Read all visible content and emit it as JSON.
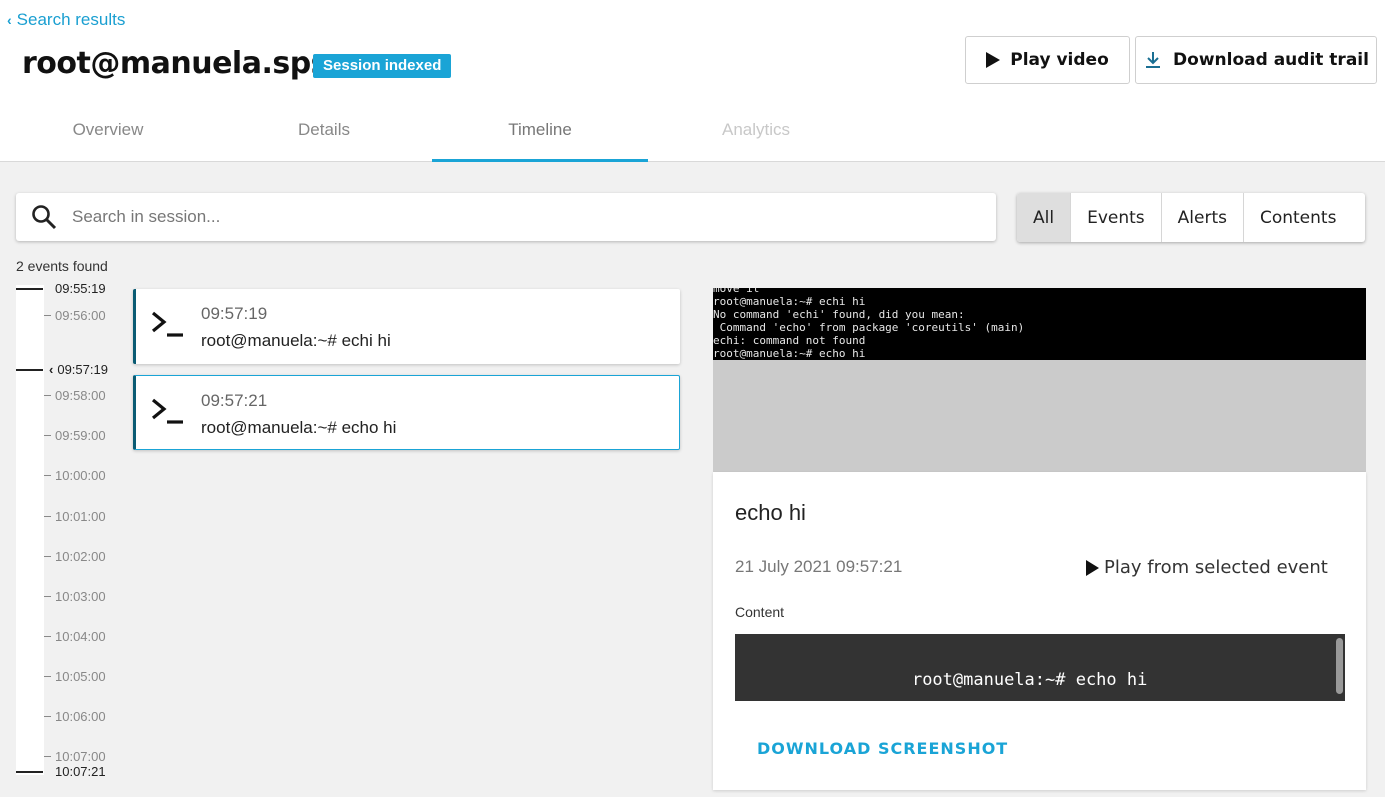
{
  "header": {
    "back_label": "Search results",
    "title": "root@manuela.sps",
    "badge": "Session indexed",
    "play_video_label": "Play video",
    "download_trail_label": "Download audit trail"
  },
  "tabs": [
    {
      "label": "Overview",
      "state": "normal"
    },
    {
      "label": "Details",
      "state": "normal"
    },
    {
      "label": "Timeline",
      "state": "active"
    },
    {
      "label": "Analytics",
      "state": "disabled"
    }
  ],
  "search": {
    "placeholder": "Search in session...",
    "value": ""
  },
  "filters": [
    "All",
    "Events",
    "Alerts",
    "Contents"
  ],
  "active_filter": "All",
  "events_count": "2 events found",
  "timeline": {
    "ticks": [
      "09:55:19",
      "09:56:00",
      "09:57:19",
      "09:58:00",
      "09:59:00",
      "10:00:00",
      "10:01:00",
      "10:02:00",
      "10:03:00",
      "10:04:00",
      "10:05:00",
      "10:06:00",
      "10:07:00",
      "10:07:21"
    ]
  },
  "events": [
    {
      "time": "09:57:19",
      "command": "root@manuela:~# echi hi"
    },
    {
      "time": "09:57:21",
      "command": "root@manuela:~# echo hi"
    }
  ],
  "screen_text": "move it\nroot@manuela:~# echi hi\nNo command 'echi' found, did you mean:\n Command 'echo' from package 'coreutils' (main)\nechi: command not found\nroot@manuela:~# echo hi",
  "detail": {
    "title": "echo hi",
    "date": "21 July 2021 09:57:21",
    "play_from_label": "Play from selected event",
    "content_label": "Content",
    "content_text": "root@manuela:~# echo hi",
    "download_label": "DOWNLOAD SCREENSHOT"
  },
  "colors": {
    "accent": "#1aa4d6",
    "card_border": "#0a5b73"
  }
}
